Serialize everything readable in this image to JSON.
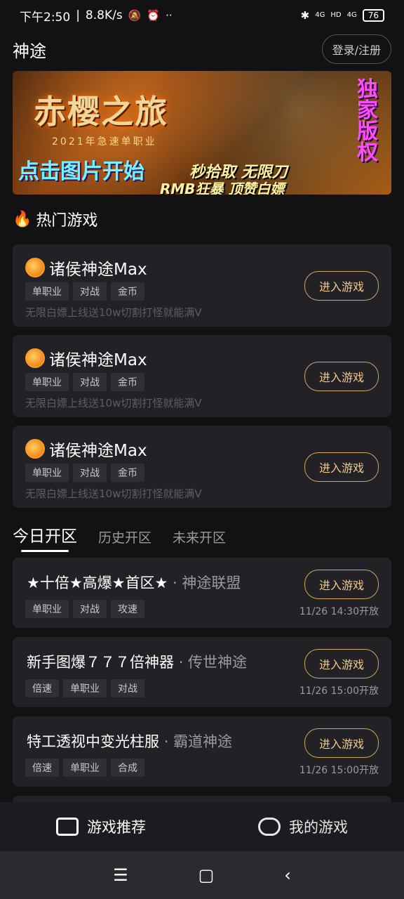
{
  "status_bar": {
    "time": "下午2:50",
    "speed": "8.8K/s",
    "battery": "76",
    "net1": "4G",
    "net2": "4G",
    "hd": "HD"
  },
  "header": {
    "title": "神途",
    "login_label": "登录/注册"
  },
  "banner": {
    "logo": "赤樱之旅",
    "year_line": "2021年急速单职业",
    "cta": "点击图片开始",
    "slogan1": "秒拾取 无限刀",
    "slogan2": "RMB狂暴 顶赞白嫖",
    "exclusive": "独家版权"
  },
  "hot_section": {
    "title": "热门游戏",
    "games": [
      {
        "name": "诸侯神途Max",
        "tags": [
          "单职业",
          "对战",
          "金币"
        ],
        "desc": "无限白嫖上线送10w切割打怪就能满V",
        "button": "进入游戏"
      },
      {
        "name": "诸侯神途Max",
        "tags": [
          "单职业",
          "对战",
          "金币"
        ],
        "desc": "无限白嫖上线送10w切割打怪就能满V",
        "button": "进入游戏"
      },
      {
        "name": "诸侯神途Max",
        "tags": [
          "单职业",
          "对战",
          "金币"
        ],
        "desc": "无限白嫖上线送10w切割打怪就能满V",
        "button": "进入游戏"
      }
    ]
  },
  "tabs": [
    "今日开区",
    "历史开区",
    "未来开区"
  ],
  "servers": [
    {
      "name": "★十倍★高爆★首区★",
      "group": "· 神途联盟",
      "tags": [
        "单职业",
        "对战",
        "攻速"
      ],
      "time": "11/26 14:30开放",
      "button": "进入游戏"
    },
    {
      "name": "新手图爆７７７倍神器",
      "group": "· 传世神途",
      "tags": [
        "倍速",
        "单职业",
        "对战"
      ],
      "time": "11/26 15:00开放",
      "button": "进入游戏"
    },
    {
      "name": "特工透视中变光柱服",
      "group": "· 霸道神途",
      "tags": [
        "倍速",
        "单职业",
        "合成"
      ],
      "time": "11/26 15:00开放",
      "button": "进入游戏"
    }
  ],
  "bottom_nav": {
    "recommend": "游戏推荐",
    "mine": "我的游戏"
  },
  "system_nav": {
    "menu": "☰",
    "home": "▢",
    "back": "‹"
  }
}
